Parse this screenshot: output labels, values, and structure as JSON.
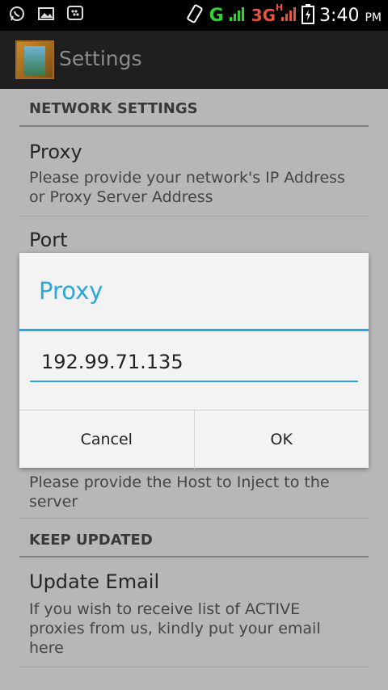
{
  "statusbar": {
    "net_g": "G",
    "net_3g": "3G",
    "net_3g_sup": "H",
    "time": "3:40",
    "ampm": "PM",
    "icons": [
      "whatsapp-icon",
      "image-icon",
      "bbm-icon",
      "signal-icon",
      "battery-icon"
    ]
  },
  "actionbar": {
    "title": "Settings"
  },
  "sections": {
    "network_header": "NETWORK SETTINGS",
    "keep_header": "KEEP UPDATED"
  },
  "prefs": {
    "proxy_title": "Proxy",
    "proxy_summary": "Please provide your network's IP Address or Proxy Server Address",
    "port_title": "Port",
    "host_summary": "Please provide the Host to Inject to the server",
    "email_title": "Update Email",
    "email_summary": "If you wish to receive list of ACTIVE proxies from us, kindly put your email here"
  },
  "dialog": {
    "title": "Proxy",
    "input_value": "192.99.71.135",
    "cancel_label": "Cancel",
    "ok_label": "OK"
  },
  "colors": {
    "accent": "#2ba7d8",
    "g_signal": "#2fd32f",
    "three_g": "#e5553b"
  }
}
